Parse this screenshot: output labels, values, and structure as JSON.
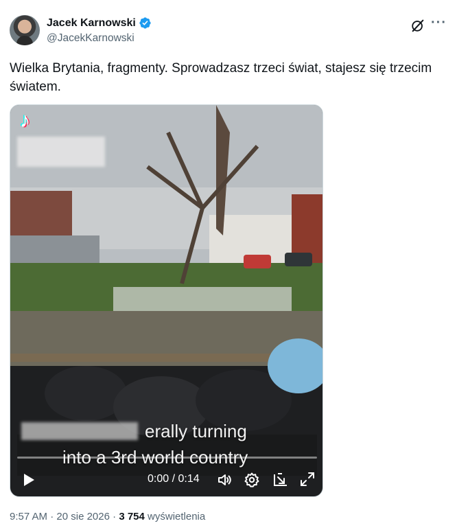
{
  "author": {
    "name": "Jacek Karnowski",
    "handle": "@JacekKarnowski",
    "verified": true,
    "avatar": "avatar-photo"
  },
  "icons": {
    "grok": "grok-slash-icon",
    "more": "more-dots-icon",
    "verified": "verified-badge-icon",
    "play": "play-icon",
    "volume": "volume-icon",
    "settings": "gear-icon",
    "pip": "picture-in-picture-icon",
    "fullscreen": "fullscreen-icon",
    "tiktok": "tiktok-logo-icon"
  },
  "tweet": {
    "text": "Wielka Brytania, fragmenty. Sprowadzasz trzeci świat, stajesz się trzecim światem."
  },
  "video": {
    "caption_line1": "erally turning",
    "caption_line2": "into a 3rd world country",
    "time": "0:00 / 0:14",
    "progress": 0.0
  },
  "meta": {
    "time": "9:57 AM",
    "separator": " · ",
    "date": "20 sie 2026",
    "views": "3 754",
    "views_label": " wyświetlenia"
  },
  "colors": {
    "verified": "#1d9bf0",
    "secondary_text": "#536471",
    "primary_text": "#0f1419"
  }
}
